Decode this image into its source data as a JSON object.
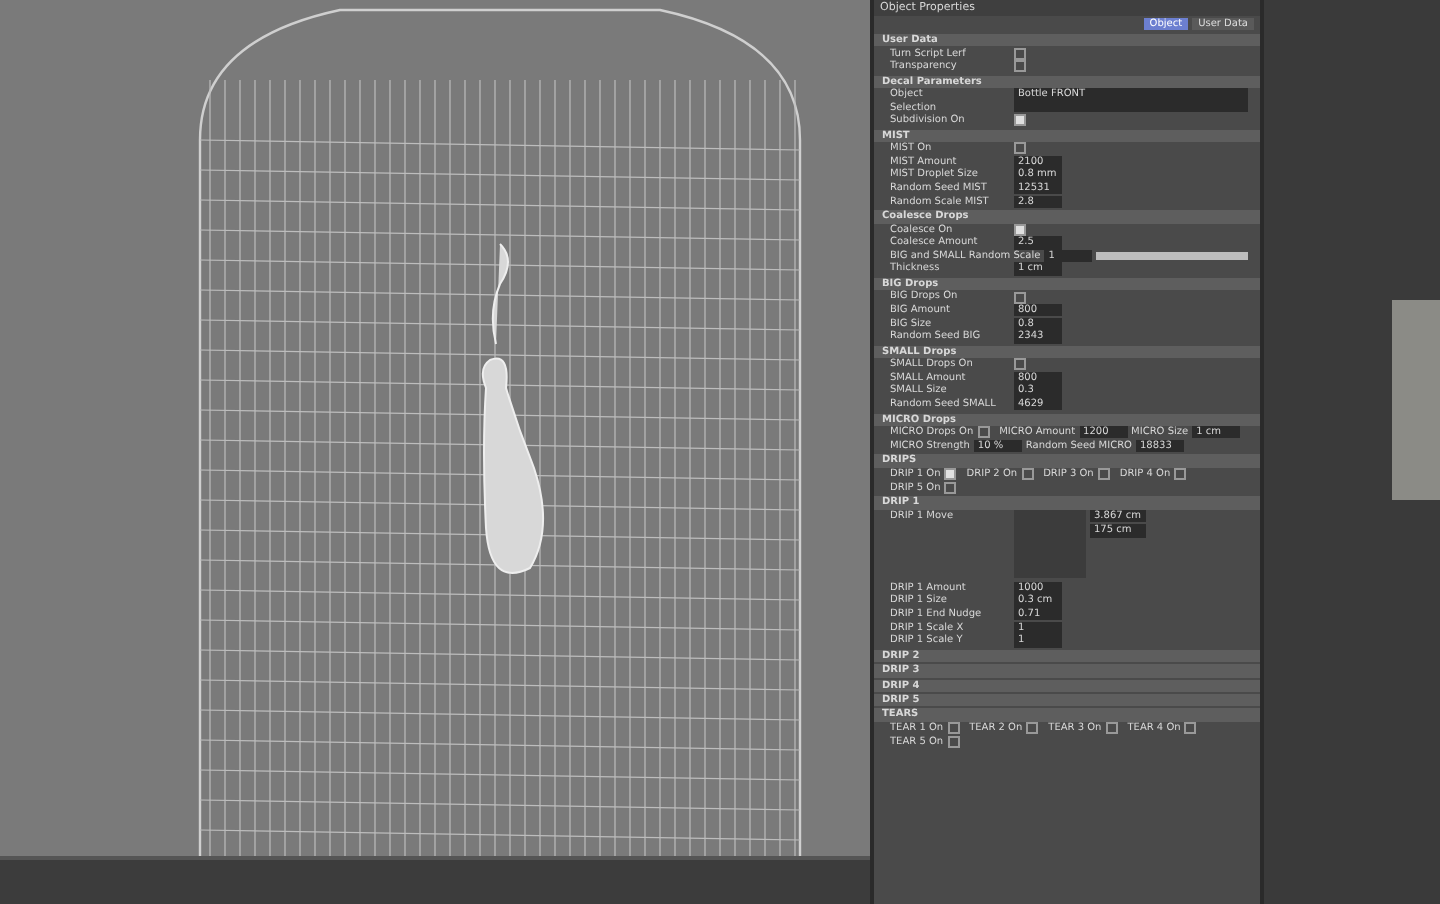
{
  "panel": {
    "title": "Object Properties",
    "tabs": [
      {
        "label": "Object",
        "selected": true
      },
      {
        "label": "User Data",
        "selected": false
      }
    ]
  },
  "sections": [
    {
      "title": "User Data",
      "rows": [
        {
          "kind": "check",
          "label": "Turn Script Lerf",
          "checked": false
        },
        {
          "kind": "check",
          "label": "Transparency",
          "checked": false
        }
      ]
    },
    {
      "title": "Decal Parameters",
      "rows": [
        {
          "kind": "link",
          "label": "Object",
          "value": "Bottle FRONT"
        },
        {
          "kind": "link",
          "label": "Selection",
          "value": ""
        },
        {
          "kind": "check",
          "label": "Subdivision On",
          "checked": true
        }
      ]
    },
    {
      "title": "MIST",
      "rows": [
        {
          "kind": "check",
          "label": "MIST On",
          "checked": false
        },
        {
          "kind": "value",
          "label": "MIST Amount",
          "value": "2100"
        },
        {
          "kind": "value",
          "label": "MIST Droplet Size",
          "value": "0.8 mm"
        },
        {
          "kind": "value",
          "label": "Random Seed MIST",
          "value": "12531"
        },
        {
          "kind": "value",
          "label": "Random Scale MIST",
          "value": "2.8"
        }
      ]
    },
    {
      "title": "Coalesce Drops",
      "rows": [
        {
          "kind": "check",
          "label": "Coalesce On",
          "checked": true
        },
        {
          "kind": "value",
          "label": "Coalesce Amount",
          "value": "2.5"
        },
        {
          "kind": "slider",
          "label": "BIG and SMALL Random Scale",
          "value": "1",
          "level": 1
        },
        {
          "kind": "value",
          "label": "Thickness",
          "value": "1 cm"
        }
      ]
    },
    {
      "title": "BIG Drops",
      "rows": [
        {
          "kind": "check",
          "label": "BIG Drops On",
          "checked": false
        },
        {
          "kind": "value",
          "label": "BIG Amount",
          "value": "800"
        },
        {
          "kind": "value",
          "label": "BIG Size",
          "value": "0.8"
        },
        {
          "kind": "value",
          "label": "Random Seed BIG",
          "value": "2343"
        }
      ]
    },
    {
      "title": "SMALL Drops",
      "rows": [
        {
          "kind": "check",
          "label": "SMALL Drops On",
          "checked": false
        },
        {
          "kind": "value",
          "label": "SMALL Amount",
          "value": "800"
        },
        {
          "kind": "value",
          "label": "SMALL Size",
          "value": "0.3"
        },
        {
          "kind": "value",
          "label": "Random Seed SMALL",
          "value": "4629"
        }
      ]
    },
    {
      "title": "MICRO Drops",
      "rows": [
        {
          "kind": "pair",
          "items": [
            {
              "label": "MICRO Drops On",
              "checked": false
            },
            {
              "label": "MICRO Amount",
              "value": "1200"
            },
            {
              "label": "MICRO Size",
              "value": "1 cm"
            }
          ]
        },
        {
          "kind": "pair",
          "items": [
            {
              "label": "MICRO Strength",
              "value": "10 %"
            },
            {
              "label": "Random Seed MICRO",
              "value": "18833"
            }
          ]
        }
      ]
    },
    {
      "title": "DRIPS",
      "rows": [
        {
          "kind": "pair",
          "items": [
            {
              "label": "DRIP 1 On",
              "checked": true
            },
            {
              "label": "DRIP 2 On",
              "checked": false
            },
            {
              "label": "DRIP 3 On",
              "checked": false
            },
            {
              "label": "DRIP 4 On",
              "checked": false
            },
            {
              "label": "DRIP 5 On",
              "checked": false
            }
          ]
        }
      ]
    },
    {
      "title": "DRIP 1",
      "rows": [
        {
          "kind": "move",
          "label": "DRIP 1 Move",
          "values": [
            "3.867 cm",
            "175 cm"
          ]
        },
        {
          "kind": "value",
          "label": "DRIP 1 Amount",
          "value": "1000"
        },
        {
          "kind": "value",
          "label": "DRIP 1 Size",
          "value": "0.3 cm"
        },
        {
          "kind": "value",
          "label": "DRIP 1 End Nudge",
          "value": "0.71"
        },
        {
          "kind": "value",
          "label": "DRIP 1 Scale X",
          "value": "1"
        },
        {
          "kind": "value",
          "label": "DRIP 1 Scale Y",
          "value": "1"
        }
      ]
    },
    {
      "title": "DRIP 2"
    },
    {
      "title": "DRIP 3"
    },
    {
      "title": "DRIP 4"
    },
    {
      "title": "DRIP 5"
    },
    {
      "title": "TEARS",
      "rows": [
        {
          "kind": "pair",
          "items": [
            {
              "label": "TEAR 1 On",
              "checked": false
            },
            {
              "label": "TEAR 2 On",
              "checked": false
            },
            {
              "label": "TEAR 3 On",
              "checked": false
            },
            {
              "label": "TEAR 4 On",
              "checked": false
            },
            {
              "label": "TEAR 5 On",
              "checked": false
            }
          ]
        }
      ]
    }
  ]
}
